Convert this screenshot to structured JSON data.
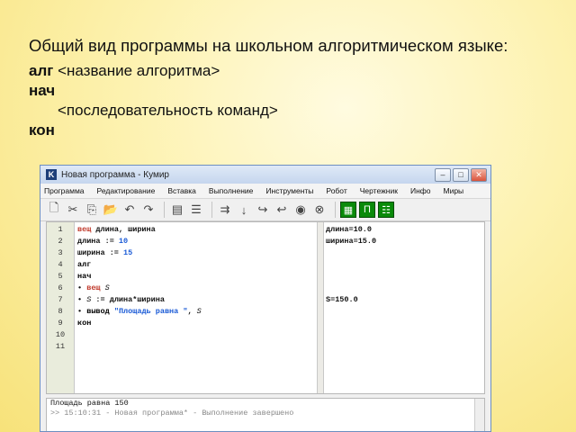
{
  "slide": {
    "intro": "Общий вид программы на школьном алгоритмическом языке:",
    "line1_kw": "алг",
    "line1_rest": " <название алгоритма>",
    "line2": "нач",
    "line3": "<последовательность команд>",
    "line4": "кон"
  },
  "window": {
    "title": "Новая программа - Кумир",
    "menu": [
      "Программа",
      "Редактирование",
      "Вставка",
      "Выполнение",
      "Инструменты",
      "Робот",
      "Чертежник",
      "Инфо",
      "Миры"
    ],
    "toolbar": [
      "new-icon",
      "cut-icon",
      "copy-icon",
      "open-icon",
      "undo-icon",
      "redo-icon",
      "sep",
      "table-icon",
      "list-icon",
      "sep",
      "run-icon",
      "step-icon",
      "step-in-icon",
      "step-out-icon",
      "stop-icon",
      "cancel-icon",
      "sep",
      "robot-icon",
      "plotter-icon",
      "world-icon"
    ],
    "editor": {
      "line_numbers": [
        "1",
        "2",
        "3",
        "4",
        "5",
        "6",
        "7",
        "8",
        "9",
        "10",
        "11"
      ],
      "margin": [
        "длина=10.0",
        "ширина=15.0",
        "",
        "",
        "",
        "",
        "S=150.0",
        "",
        "",
        "",
        ""
      ]
    },
    "console": {
      "line1": "Площадь равна 150",
      "line2": ">> 15:10:31 - Новая программа* - Выполнение завершено"
    }
  },
  "code": {
    "l1_kw": "вещ",
    "l1_rest": " длина, ширина",
    "l2_a": "длина := ",
    "l2_num": "10",
    "l3_a": "ширина := ",
    "l3_num": "15",
    "l4": "алг",
    "l5": "нач",
    "l6_bullet": "•",
    "l6_kw": "вещ",
    "l6_var": "S",
    "l7_bullet": "•",
    "l7_var": "S",
    "l7_rest": " := длина*ширина",
    "l8_bullet": "•",
    "l8_kw": "вывод",
    "l8_str": "\"Площадь равна \"",
    "l8_rest": ", ",
    "l8_var": "S",
    "l9": "кон"
  }
}
